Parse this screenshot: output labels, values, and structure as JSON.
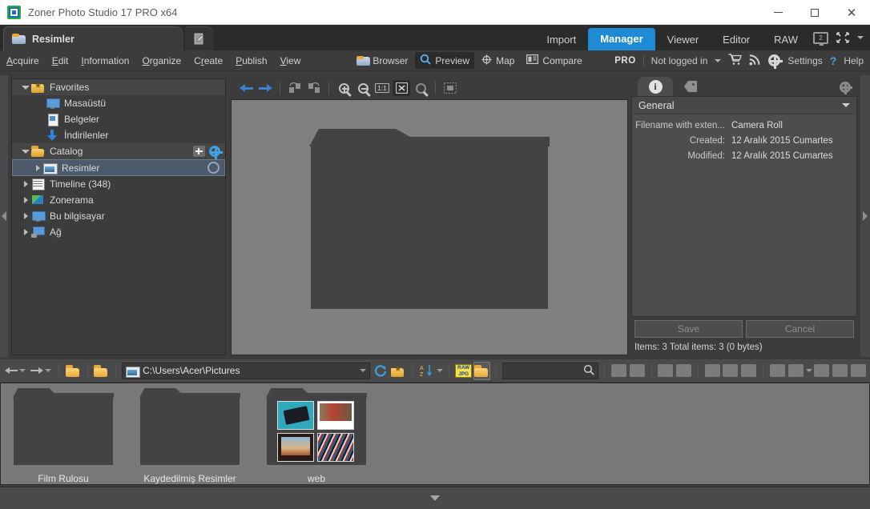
{
  "window": {
    "title": "Zoner Photo Studio 17 PRO x64",
    "minimize": "—",
    "maximize": "□",
    "close": "✕"
  },
  "tabs": {
    "document_tab": "Resimler",
    "edit_tab_icon": "edit-note-icon"
  },
  "modes": [
    {
      "label": "Import",
      "active": false
    },
    {
      "label": "Manager",
      "active": true
    },
    {
      "label": "Viewer",
      "active": false
    },
    {
      "label": "Editor",
      "active": false
    },
    {
      "label": "RAW",
      "active": false
    }
  ],
  "display": {
    "monitor_count": "2"
  },
  "menu": [
    {
      "label": "Acquire",
      "accel": "A"
    },
    {
      "label": "Edit",
      "accel": "E"
    },
    {
      "label": "Information",
      "accel": "I"
    },
    {
      "label": "Organize",
      "accel": "O"
    },
    {
      "label": "Create",
      "accel": "r"
    },
    {
      "label": "Publish",
      "accel": "P"
    },
    {
      "label": "View",
      "accel": "V"
    }
  ],
  "view_modes": [
    {
      "label": "Browser",
      "icon": "folder-icon",
      "active": false
    },
    {
      "label": "Preview",
      "icon": "magnifier-icon",
      "active": true
    },
    {
      "label": "Map",
      "icon": "target-icon",
      "active": false
    },
    {
      "label": "Compare",
      "icon": "compare-icon",
      "active": false
    }
  ],
  "account": {
    "pro_badge": "PRO",
    "login_status": "Not logged in",
    "cart_icon": "cart-icon",
    "rss_icon": "rss-icon",
    "settings_label": "Settings",
    "help_label": "Help",
    "help_icon": "question-mark-icon"
  },
  "tree": [
    {
      "label": "Favorites",
      "icon": "favorites-folder-icon",
      "expanded": true,
      "indent": 0,
      "group": true
    },
    {
      "label": "Masaüstü",
      "icon": "desktop-icon",
      "indent": 1
    },
    {
      "label": "Belgeler",
      "icon": "documents-icon",
      "indent": 1
    },
    {
      "label": "İndirilenler",
      "icon": "downloads-icon",
      "indent": 1
    },
    {
      "label": "Catalog",
      "icon": "catalog-folder-icon",
      "expanded": true,
      "indent": 0,
      "group": true,
      "actions": [
        "add-folder-icon",
        "catalog-settings-gear-icon"
      ]
    },
    {
      "label": "Resimler",
      "icon": "pictures-icon",
      "indent": 1,
      "selected": true,
      "collapsed": true,
      "actions": [
        "sync-icon"
      ]
    },
    {
      "label": "Timeline (348)",
      "icon": "calendar-icon",
      "indent": 0,
      "collapsed": true
    },
    {
      "label": "Zonerama",
      "icon": "zonerama-icon",
      "indent": 0,
      "collapsed": true
    },
    {
      "label": "Bu bilgisayar",
      "icon": "computer-icon",
      "indent": 0,
      "collapsed": true
    },
    {
      "label": "Ağ",
      "icon": "network-icon",
      "indent": 0,
      "collapsed": true
    }
  ],
  "preview_toolbar": [
    {
      "name": "back-arrow-icon",
      "active": false
    },
    {
      "name": "forward-arrow-icon",
      "active": false
    },
    {
      "name": "rotate-left-icon",
      "active": false
    },
    {
      "name": "rotate-right-icon",
      "active": false
    },
    {
      "name": "zoom-in-icon",
      "active": false
    },
    {
      "name": "zoom-out-icon",
      "active": false
    },
    {
      "name": "zoom-100-icon",
      "label": "1:1",
      "active": false
    },
    {
      "name": "fit-to-window-icon",
      "active": true
    },
    {
      "name": "zoom-area-icon",
      "active": false
    },
    {
      "name": "thumbnail-grid-icon",
      "active": false
    }
  ],
  "preview": {
    "content_icon": "large-folder-icon"
  },
  "info_panel": {
    "tabs": [
      {
        "name": "info-tab",
        "icon": "info-circle-icon",
        "active": true
      },
      {
        "name": "keywords-tab",
        "icon": "tag-icon",
        "active": false
      }
    ],
    "settings_icon": "panel-gear-icon",
    "section_title": "General",
    "fields": [
      {
        "key": "Filename with exten...",
        "value": "Camera Roll"
      },
      {
        "key": "Created:",
        "value": "12 Aralık 2015 Cumartes"
      },
      {
        "key": "Modified:",
        "value": "12 Aralık 2015 Cumartes"
      }
    ],
    "save_label": "Save",
    "cancel_label": "Cancel",
    "status": "Items: 3    Total items: 3 (0 bytes)"
  },
  "address_bar": {
    "back_icon": "nav-back-icon",
    "forward_icon": "nav-forward-icon",
    "up_folder_icon": "up-folder-icon",
    "new_folder_icon": "new-folder-icon",
    "path_icon": "pictures-icon",
    "path": "C:\\Users\\Acer\\Pictures",
    "dropdown_icon": "chevron-down-icon",
    "refresh_icon": "refresh-icon",
    "favorites_icon": "add-favorite-icon",
    "sort_icon": "sort-az-icon",
    "rawjpg_label": "RAW\nJPG",
    "filter_folder_icon": "filter-folder-icon",
    "search_value": "",
    "search_icon": "search-icon",
    "right_icons": [
      "rotate-left-icon",
      "rotate-right-icon",
      "print-icon",
      "email-icon",
      "contact-sheet-icon",
      "copy-icon",
      "archive-icon",
      "publish-icon",
      "slideshow-icon",
      "export-icon",
      "wallpaper-icon",
      "batch-icon"
    ]
  },
  "thumbnails": [
    {
      "label": "Film Rulosu",
      "type": "folder",
      "has_preview": false
    },
    {
      "label": "Kaydedilmiş Resimler",
      "type": "folder",
      "has_preview": false
    },
    {
      "label": "web",
      "type": "folder",
      "has_preview": true
    }
  ],
  "statusbar": {
    "collapse_icon": "chevron-down-icon"
  },
  "colors": {
    "accent": "#1e8bd4",
    "window_bg": "#3c3c3c",
    "panel_bg": "#4d4d4d",
    "preview_bg": "#808080",
    "strip_bg": "#787878",
    "selection": "#4c5a6b",
    "folder_yellow": "#e8a93a"
  }
}
